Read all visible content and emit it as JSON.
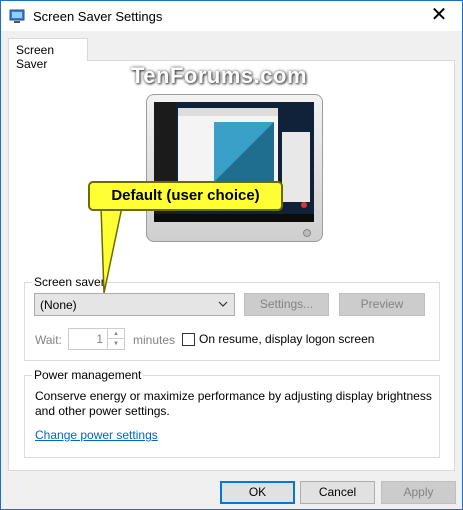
{
  "window": {
    "title": "Screen Saver Settings",
    "close_glyph": "✕"
  },
  "tab": {
    "label": "Screen Saver"
  },
  "preview": {
    "watermark": "TenForums.com"
  },
  "callout": {
    "text": "Default (user choice)"
  },
  "screen_saver": {
    "group_label": "Screen saver",
    "selected": "(None)",
    "settings_label": "Settings...",
    "preview_label": "Preview",
    "wait_label": "Wait:",
    "wait_value": "1",
    "minutes_label": "minutes",
    "resume_label": "On resume, display logon screen",
    "resume_checked": false
  },
  "power": {
    "group_label": "Power management",
    "description": "Conserve energy or maximize performance by adjusting display brightness and other power settings.",
    "link": "Change power settings"
  },
  "buttons": {
    "ok": "OK",
    "cancel": "Cancel",
    "apply": "Apply"
  },
  "colors": {
    "callout": "#ffff33",
    "link": "#0066cc",
    "accent": "#0078d7"
  }
}
